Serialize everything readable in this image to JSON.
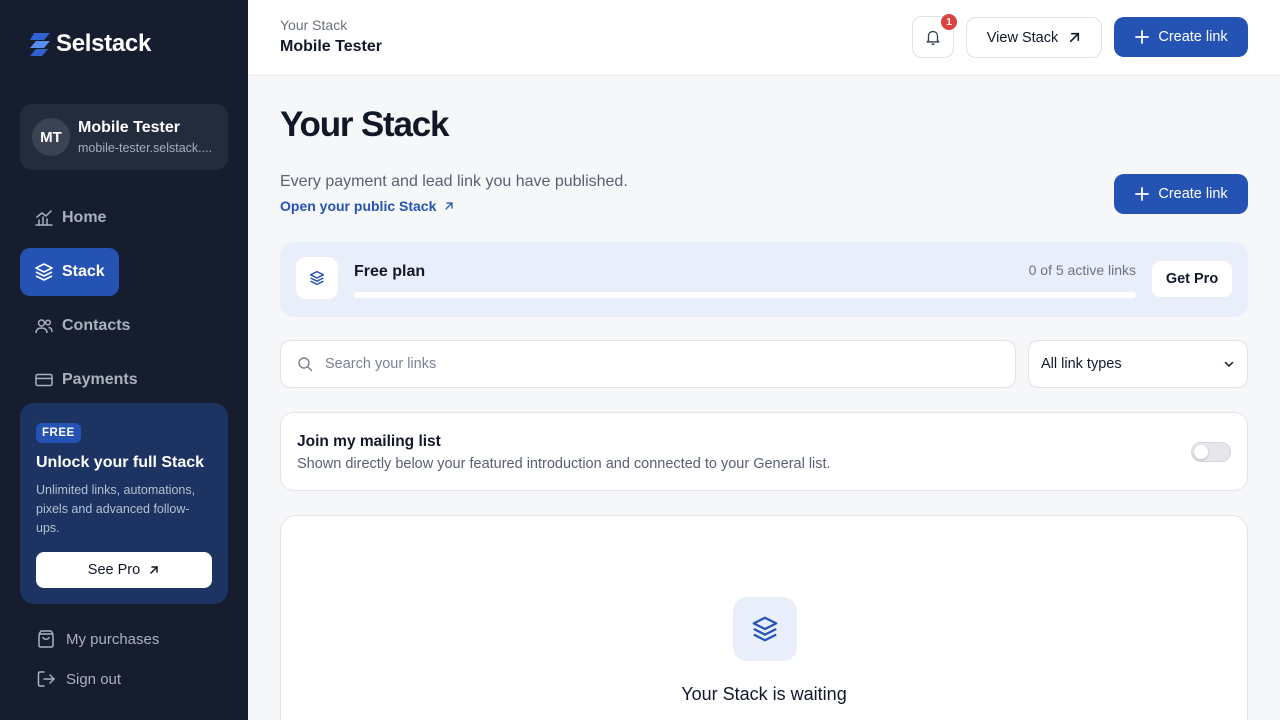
{
  "brand": {
    "name": "Selstack",
    "accent": "#2453b4",
    "sidebar_bg": "#151d2e"
  },
  "profile": {
    "initials": "MT",
    "name": "Mobile Tester",
    "url": "mobile-tester.selstack...."
  },
  "nav": [
    {
      "label": "Home",
      "icon": "chart-icon",
      "active": false
    },
    {
      "label": "Stack",
      "icon": "layers-icon",
      "active": true
    },
    {
      "label": "Contacts",
      "icon": "users-icon",
      "active": false
    },
    {
      "label": "Payments",
      "icon": "credit-card-icon",
      "active": false
    }
  ],
  "promo": {
    "badge": "FREE",
    "title": "Unlock your full Stack",
    "description": "Unlimited links, automations, pixels and advanced follow-ups.",
    "button": "See Pro"
  },
  "bottom_links": {
    "purchases": "My purchases",
    "signout": "Sign out"
  },
  "topbar": {
    "breadcrumb": "Your Stack",
    "title": "Mobile Tester",
    "notification_count": "1",
    "view_stack": "View Stack",
    "create_link": "Create link"
  },
  "main": {
    "title": "Your Stack",
    "subtitle": "Every payment and lead link you have published.",
    "public_link": "Open your public Stack",
    "create_link": "Create link"
  },
  "plan": {
    "name": "Free plan",
    "count_text": "0 of 5 active links",
    "progress_fraction": 0,
    "cta": "Get Pro"
  },
  "search": {
    "placeholder": "Search your links",
    "value": ""
  },
  "filter": {
    "selected": "All link types"
  },
  "mailing": {
    "title": "Join my mailing list",
    "description": "Shown directly below your featured introduction and connected to your General list.",
    "enabled": false
  },
  "empty_state": {
    "title": "Your Stack is waiting"
  }
}
